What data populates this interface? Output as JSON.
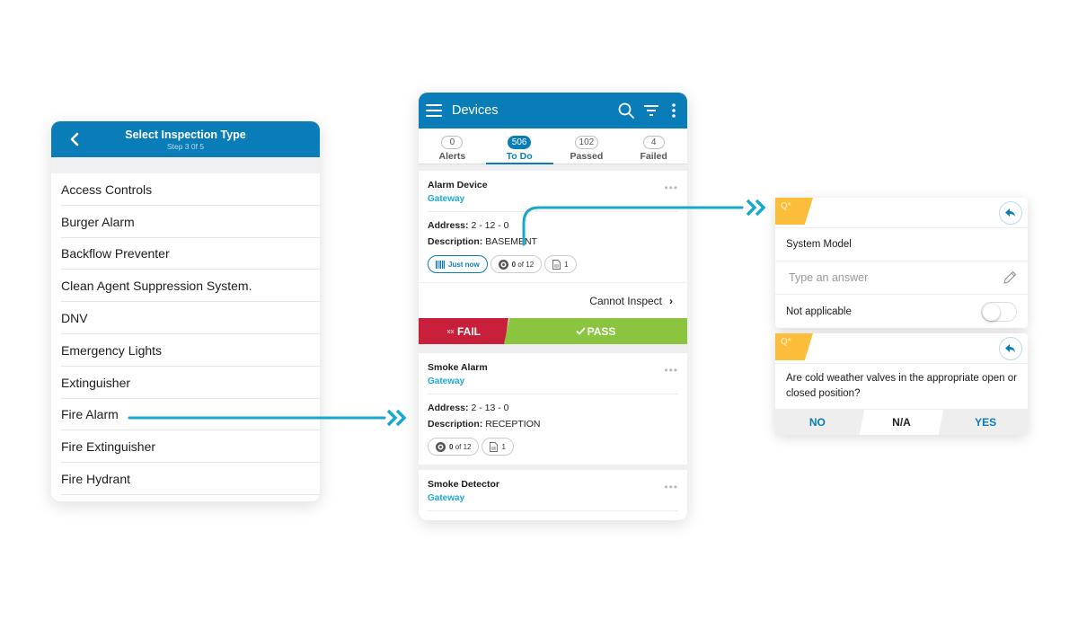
{
  "inspection_type": {
    "title": "Select Inspection Type",
    "step": "Step 3 0f 5",
    "items": [
      "Access Controls",
      "Burger Alarm",
      "Backflow Preventer",
      "Clean Agent Suppression System.",
      "DNV",
      "Emergency Lights",
      "Extinguisher",
      "Fire Alarm",
      "Fire Extinguisher",
      "Fire Hydrant"
    ]
  },
  "devices": {
    "title": "Devices",
    "tabs": [
      {
        "count": "0",
        "label": "Alerts"
      },
      {
        "count": "506",
        "label": "To Do"
      },
      {
        "count": "102",
        "label": "Passed"
      },
      {
        "count": "4",
        "label": "Failed"
      }
    ],
    "cards": [
      {
        "title": "Alarm Device",
        "subtitle": "Gateway",
        "address_label": "Address:",
        "address": "2 - 12 - 0",
        "description_label": "Description:",
        "description": "BASEMENT",
        "scan_chip": "Just now",
        "questions_chip_bold": "0",
        "questions_chip": "of 12",
        "docs_chip": "1",
        "cannot_inspect": "Cannot Inspect",
        "fail_label": "FAIL",
        "pass_label": "PASS"
      },
      {
        "title": "Smoke Alarm",
        "subtitle": "Gateway",
        "address_label": "Address:",
        "address": "2 - 13 - 0",
        "description_label": "Description:",
        "description": "RECEPTION",
        "questions_chip_bold": "0",
        "questions_chip": "of 12",
        "docs_chip": "1"
      },
      {
        "title": "Smoke Detector",
        "subtitle": "Gateway"
      }
    ]
  },
  "questions": [
    {
      "flag": "Q*",
      "prompt": "System Model",
      "placeholder": "Type an answer",
      "not_applicable_label": "Not applicable",
      "not_applicable": false
    },
    {
      "flag": "Q*",
      "prompt": "Are cold weather valves in the appropriate open or closed position?",
      "answers": [
        "NO",
        "N/A",
        "YES"
      ],
      "selected": "N/A"
    }
  ],
  "colors": {
    "brand": "#0a7db8",
    "connector": "#17a9c9",
    "fail": "#c8203a",
    "pass": "#8bc43f",
    "flag": "#fbbd3a"
  }
}
